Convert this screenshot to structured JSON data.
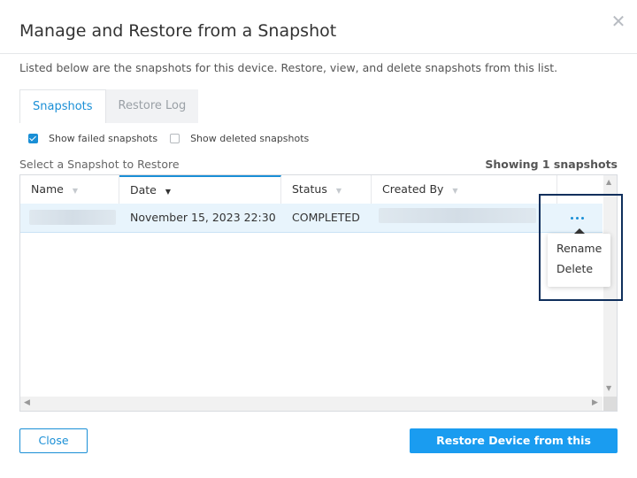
{
  "dialog": {
    "title": "Manage and Restore from a Snapshot",
    "close_icon": "close-icon",
    "description": "Listed below are the snapshots for this device. Restore, view, and delete snapshots from this list."
  },
  "tabs": [
    {
      "label": "Snapshots",
      "active": true
    },
    {
      "label": "Restore Log",
      "active": false
    }
  ],
  "filters": {
    "show_failed": {
      "label": "Show failed snapshots",
      "checked": true
    },
    "show_deleted": {
      "label": "Show deleted snapshots",
      "checked": false
    }
  },
  "grid": {
    "select_label": "Select a Snapshot to Restore",
    "showing": "Showing 1 snapshots",
    "columns": [
      "Name",
      "Date",
      "Status",
      "Created By"
    ],
    "sorted_column": "Date",
    "rows": [
      {
        "name": "",
        "date": "November 15, 2023 22:30",
        "status": "COMPLETED",
        "created_by": ""
      }
    ]
  },
  "context_menu": {
    "items": [
      "Rename",
      "Delete"
    ]
  },
  "footer": {
    "close_label": "Close",
    "restore_label": "Restore Device from this Snapshot"
  },
  "colors": {
    "accent": "#1a8fd6",
    "primary_button": "#1a9cf0",
    "highlight_border": "#0f2f5c"
  }
}
